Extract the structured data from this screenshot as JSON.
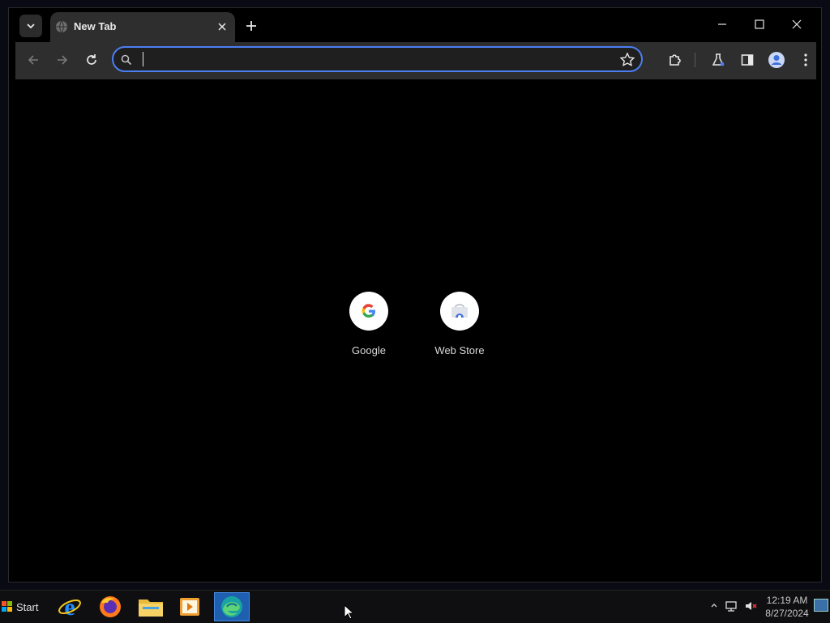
{
  "browser": {
    "tab": {
      "title": "New Tab",
      "favicon": "globe-icon"
    },
    "omnibox": {
      "value": "",
      "placeholder": ""
    },
    "toolbar_icons": [
      "back-arrow-icon",
      "forward-arrow-icon",
      "reload-icon",
      "search-icon",
      "star-icon",
      "extensions-icon",
      "labs-flask-icon",
      "side-panel-icon",
      "profile-icon",
      "menu-kebab-icon"
    ],
    "window_controls": [
      "minimize-icon",
      "maximize-icon",
      "close-icon"
    ]
  },
  "shortcuts": [
    {
      "label": "Google",
      "icon": "google-g-icon"
    },
    {
      "label": "Web Store",
      "icon": "web-store-icon"
    }
  ],
  "taskbar": {
    "start_label": "Start",
    "apps": [
      "internet-explorer-icon",
      "firefox-icon",
      "file-explorer-icon",
      "media-player-icon",
      "edge-icon"
    ],
    "clock_time": "12:19 AM",
    "clock_date": "8/27/2024"
  },
  "colors": {
    "accent": "#4c7ef3",
    "toolbar": "#2e2e2e",
    "page_bg": "#000000"
  }
}
